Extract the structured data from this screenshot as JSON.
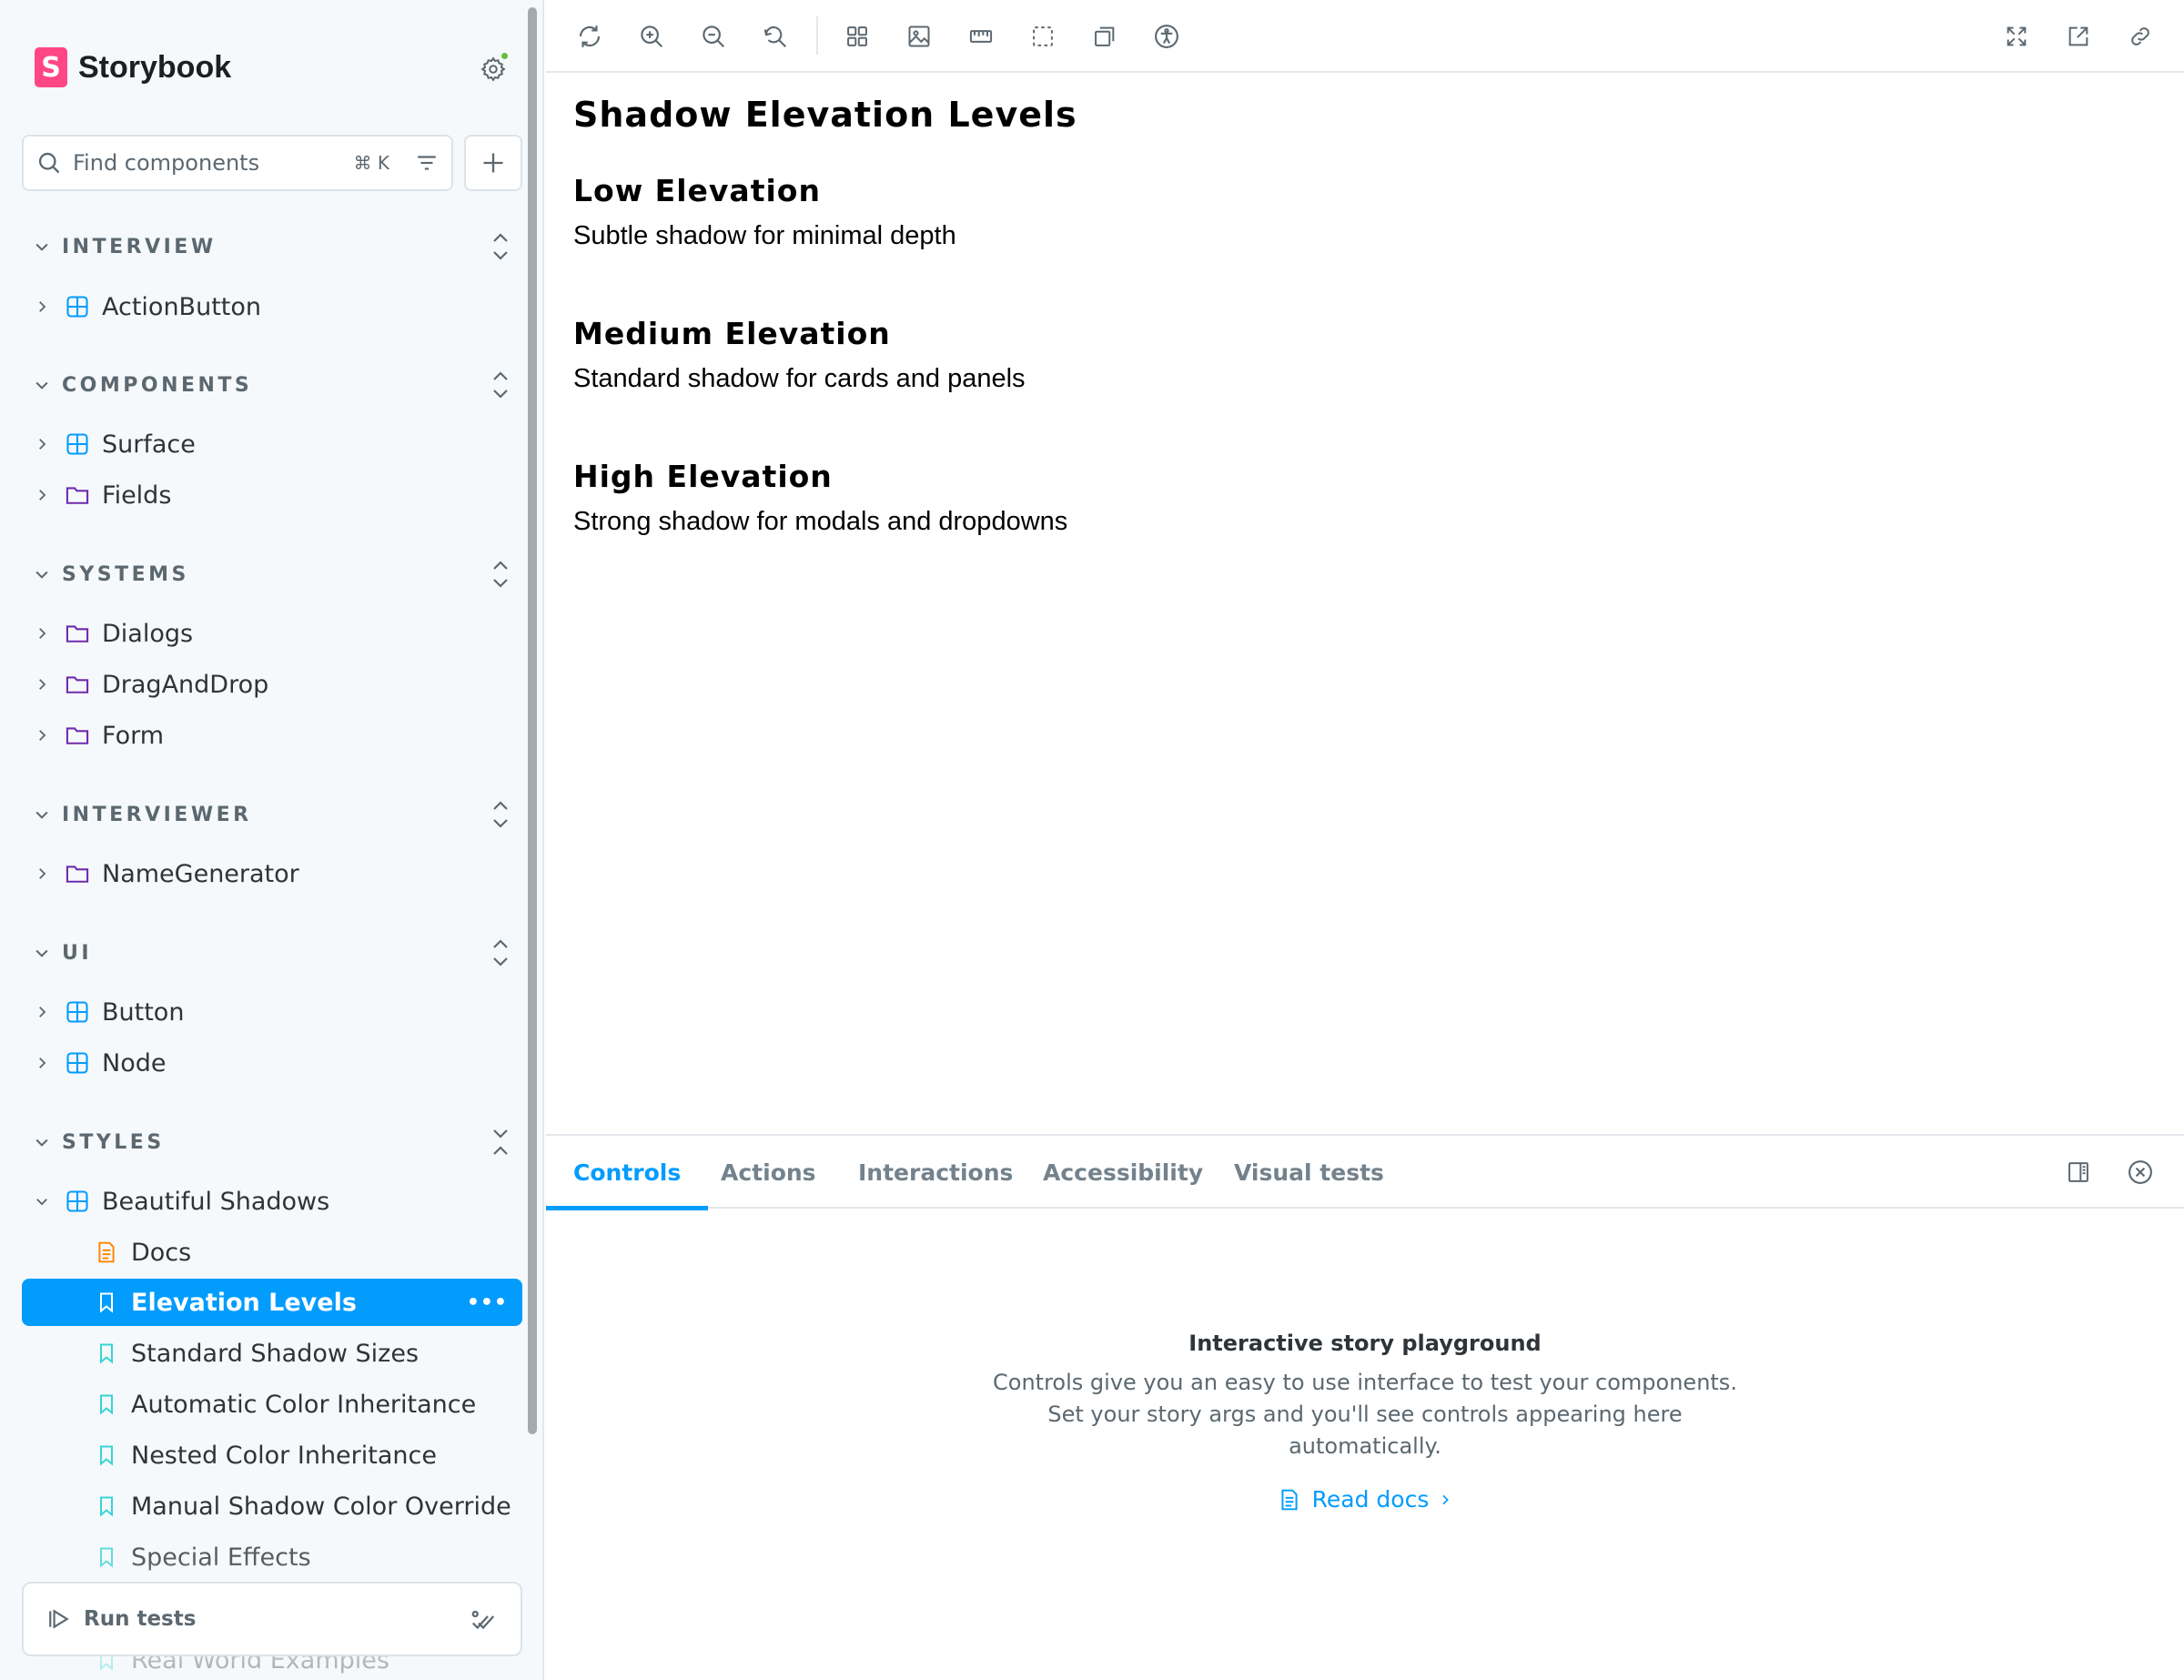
{
  "app": {
    "name": "Storybook"
  },
  "search": {
    "placeholder": "Find components",
    "shortcut": "⌘ K"
  },
  "sidebar": {
    "groups": [
      {
        "label": "INTERVIEW",
        "items": [
          {
            "label": "ActionButton",
            "icon": "component-icon"
          }
        ]
      },
      {
        "label": "COMPONENTS",
        "items": [
          {
            "label": "Surface",
            "icon": "component-icon"
          },
          {
            "label": "Fields",
            "icon": "folder-icon"
          }
        ]
      },
      {
        "label": "SYSTEMS",
        "items": [
          {
            "label": "Dialogs",
            "icon": "folder-icon"
          },
          {
            "label": "DragAndDrop",
            "icon": "folder-icon"
          },
          {
            "label": "Form",
            "icon": "folder-icon"
          }
        ]
      },
      {
        "label": "INTERVIEWER",
        "items": [
          {
            "label": "NameGenerator",
            "icon": "folder-icon"
          }
        ]
      },
      {
        "label": "UI",
        "items": [
          {
            "label": "Button",
            "icon": "component-icon"
          },
          {
            "label": "Node",
            "icon": "component-icon"
          }
        ]
      },
      {
        "label": "STYLES",
        "items": [
          {
            "label": "Beautiful Shadows",
            "icon": "component-icon"
          }
        ]
      }
    ],
    "stories": [
      {
        "label": "Docs",
        "icon": "document-icon"
      },
      {
        "label": "Elevation Levels",
        "icon": "bookmark-icon",
        "selected": true
      },
      {
        "label": "Standard Shadow Sizes",
        "icon": "bookmark-icon"
      },
      {
        "label": "Automatic Color Inheritance",
        "icon": "bookmark-icon"
      },
      {
        "label": "Nested Color Inheritance",
        "icon": "bookmark-icon"
      },
      {
        "label": "Manual Shadow Color Override",
        "icon": "bookmark-icon"
      },
      {
        "label": "Special Effects",
        "icon": "bookmark-icon"
      },
      {
        "label": "Real World Examples",
        "icon": "bookmark-icon"
      }
    ],
    "run_tests": "Run tests"
  },
  "preview": {
    "title": "Shadow Elevation Levels",
    "sections": [
      {
        "heading": "Low Elevation",
        "text": "Subtle shadow for minimal depth"
      },
      {
        "heading": "Medium Elevation",
        "text": "Standard shadow for cards and panels"
      },
      {
        "heading": "High Elevation",
        "text": "Strong shadow for modals and dropdowns"
      }
    ]
  },
  "addons": {
    "tabs": [
      "Controls",
      "Actions",
      "Interactions",
      "Accessibility",
      "Visual tests"
    ],
    "active_tab": "Controls",
    "empty_title": "Interactive story playground",
    "empty_desc": "Controls give you an easy to use interface to test your components. Set your story args and you'll see controls appearing here automatically.",
    "read_docs": "Read docs"
  },
  "colors": {
    "accent": "#029cfd",
    "brand": "#ff4785",
    "folder": "#6f2cac",
    "doc": "#ff8300",
    "story": "#37d5d3",
    "status": "#66bf3c"
  }
}
